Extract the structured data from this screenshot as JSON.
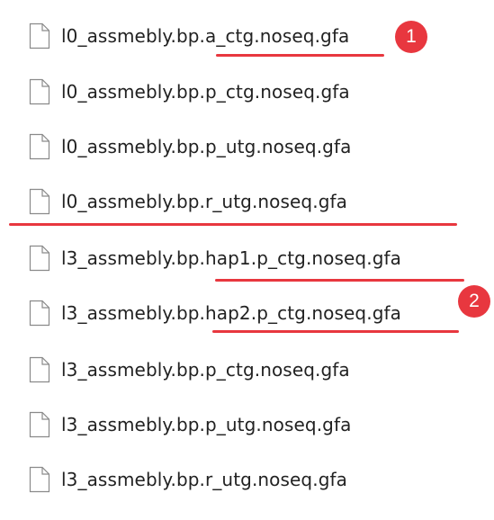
{
  "colors": {
    "annotation_red": "#e8373f",
    "text": "#222222",
    "icon_stroke": "#8a8a8a"
  },
  "icon": "file-icon",
  "files": [
    {
      "name": "l0_assmebly.bp.a_ctg.noseq.gfa"
    },
    {
      "name": "l0_assmebly.bp.p_ctg.noseq.gfa"
    },
    {
      "name": "l0_assmebly.bp.p_utg.noseq.gfa"
    },
    {
      "name": "l0_assmebly.bp.r_utg.noseq.gfa"
    },
    {
      "name": "l3_assmebly.bp.hap1.p_ctg.noseq.gfa"
    },
    {
      "name": "l3_assmebly.bp.hap2.p_ctg.noseq.gfa"
    },
    {
      "name": "l3_assmebly.bp.p_ctg.noseq.gfa"
    },
    {
      "name": "l3_assmebly.bp.p_utg.noseq.gfa"
    },
    {
      "name": "l3_assmebly.bp.r_utg.noseq.gfa"
    }
  ],
  "annotations": {
    "badge_1": "1",
    "badge_2": "2"
  }
}
